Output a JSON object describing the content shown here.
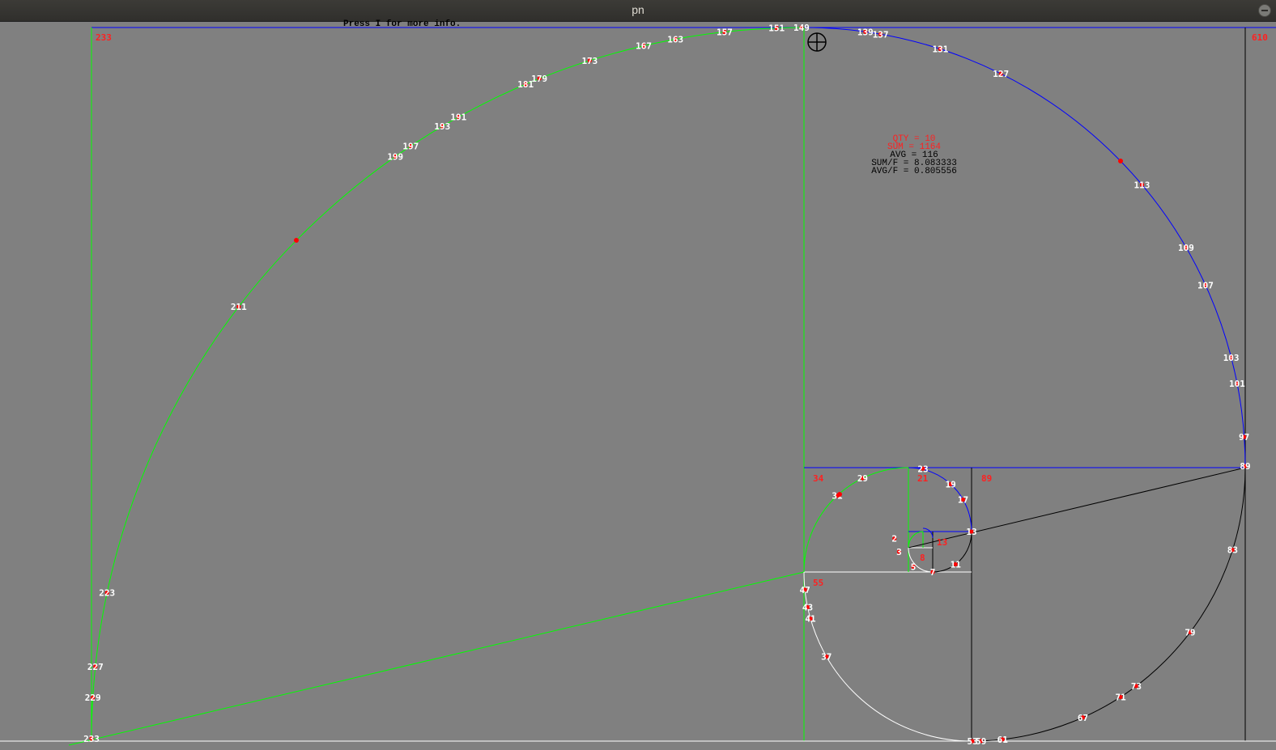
{
  "window": {
    "title": "pn"
  },
  "help_text": "Press I for more info.",
  "stats": {
    "qty": "QTY = 10",
    "sum": "SUM = 1164",
    "avg": "AVG = 116",
    "sum_f": "SUM/F = 8.083333",
    "avg_f": "AVG/F = 0.805556"
  },
  "fib_labels": [
    "233",
    "610",
    "89",
    "55",
    "34",
    "21",
    "13",
    "8"
  ],
  "colors": {
    "green": "#00ff00",
    "blue": "#0000ff",
    "white": "#ffffff",
    "black": "#000000",
    "red": "#ff0000",
    "background": "#808080"
  },
  "spiral_points": {
    "green_large": [
      "151",
      "149",
      "157",
      "163",
      "167",
      "173",
      "179",
      "181",
      "191",
      "193",
      "197",
      "199",
      "211",
      "223",
      "227",
      "229",
      "233"
    ],
    "blue_large": [
      "139",
      "137",
      "131",
      "127",
      "113",
      "109",
      "107",
      "103",
      "101",
      "97",
      "89"
    ],
    "black_large": [
      "83",
      "79",
      "73",
      "71",
      "67",
      "61",
      "59",
      "53"
    ],
    "white": [
      "37",
      "41",
      "43",
      "47"
    ],
    "green_small": [
      "23",
      "29",
      "31"
    ],
    "blue_small": [
      "19",
      "17"
    ],
    "inner": [
      "13",
      "11",
      "7",
      "5",
      "3",
      "2"
    ],
    "unlabeled_count": 3
  },
  "icons": [
    "crosshair-icon",
    "close-icon"
  ]
}
